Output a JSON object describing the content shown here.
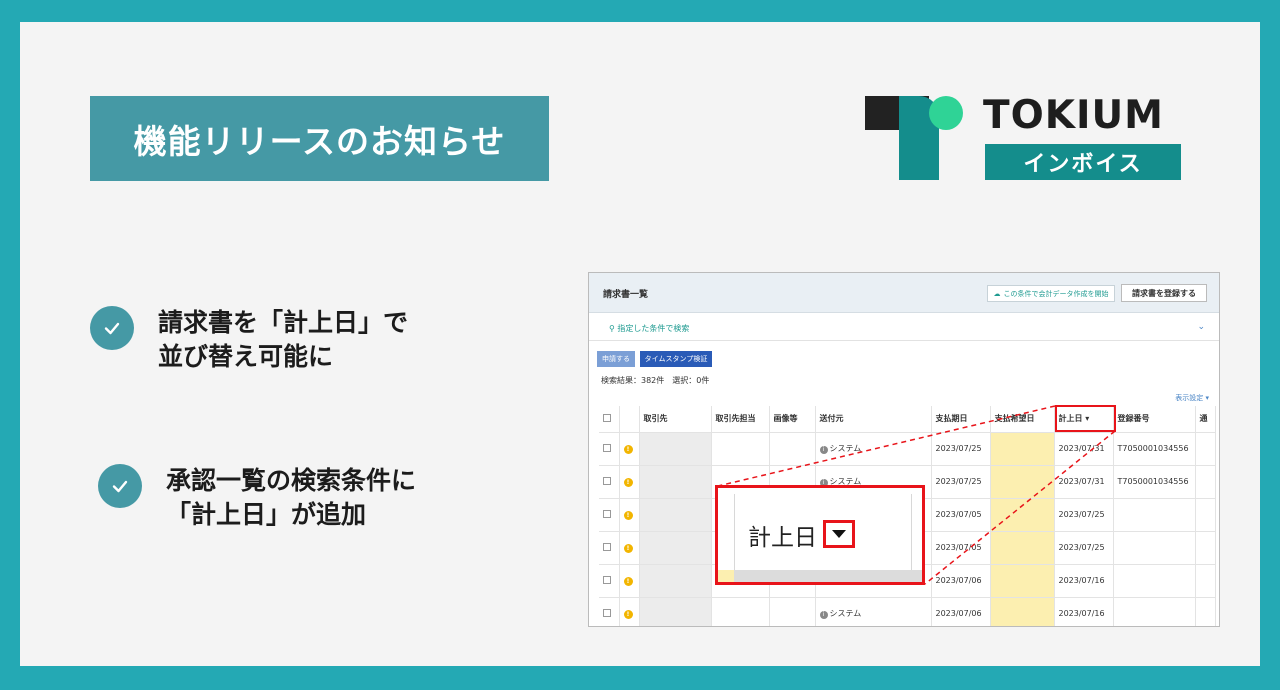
{
  "title": "機能リリースのお知らせ",
  "logo": {
    "word": "TOKIUM",
    "sub": "インボイス"
  },
  "features": [
    {
      "lines": [
        "請求書を「計上日」で",
        "並び替え可能に"
      ]
    },
    {
      "lines": [
        "承認一覧の検索条件に",
        "「計上日」が追加"
      ]
    }
  ],
  "screenshot": {
    "title": "請求書一覧",
    "export_button": "この条件で会計データ作成を開始",
    "register_button": "請求書を登録する",
    "search_label": "指定した条件で検索",
    "apply_button": "申請する",
    "stamp_button": "タイムスタンプ検証",
    "result_text": "検索結果：382件　選択：0件",
    "display_settings": "表示設定 ▾",
    "columns": [
      "取引先",
      "取引先担当",
      "画像等",
      "送付元",
      "支払期日",
      "支払希望日",
      "計上日 ▾",
      "登録番号",
      "通"
    ],
    "rows": [
      {
        "sender": "システム",
        "due": "2023/07/25",
        "booking": "2023/07/31",
        "reg": "T7050001034556"
      },
      {
        "sender": "システム",
        "due": "2023/07/25",
        "booking": "2023/07/31",
        "reg": "T7050001034556"
      },
      {
        "sender": "",
        "due": "2023/07/05",
        "booking": "2023/07/25",
        "reg": ""
      },
      {
        "sender": "",
        "due": "2023/07/05",
        "booking": "2023/07/25",
        "reg": ""
      },
      {
        "sender": "",
        "due": "2023/07/06",
        "booking": "2023/07/16",
        "reg": ""
      },
      {
        "sender": "システム",
        "due": "2023/07/06",
        "booking": "2023/07/16",
        "reg": ""
      }
    ],
    "zoom_label": "計上日"
  },
  "colors": {
    "frame": "#24a9b4",
    "accent": "#4599a5",
    "highlight": "#e8141a",
    "brand_green": "#148d8c"
  }
}
